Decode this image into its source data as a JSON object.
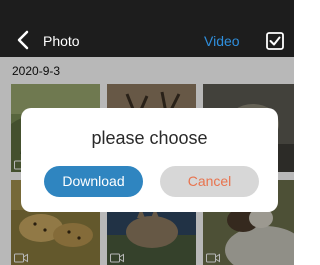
{
  "header": {
    "title": "Photo",
    "video_tab": "Video",
    "back_icon": "chevron-left-icon",
    "select_icon": "checkbox-icon"
  },
  "gallery": {
    "date": "2020-9-3",
    "thumbnails": [
      {
        "subject": "grass-field"
      },
      {
        "subject": "deer-antlers"
      },
      {
        "subject": "animal-in-shadows"
      },
      {
        "subject": "cheetahs"
      },
      {
        "subject": "wolf"
      },
      {
        "subject": "goat-on-rocks"
      }
    ]
  },
  "dialog": {
    "title": "please choose",
    "download_label": "Download",
    "cancel_label": "Cancel"
  },
  "colors": {
    "accent": "#2f85c0",
    "cancel_text": "#e8744f",
    "header_bg": "#1d1d1d"
  }
}
